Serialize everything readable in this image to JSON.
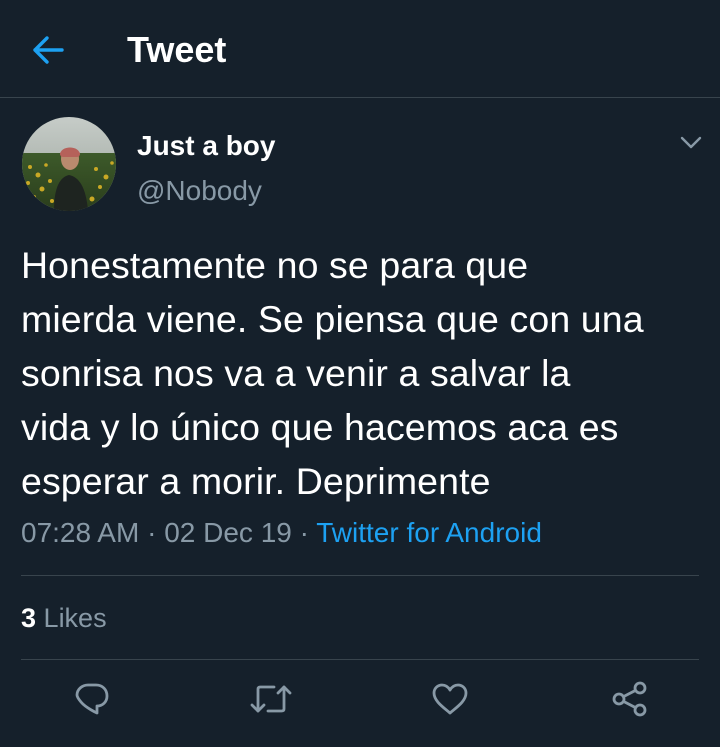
{
  "header": {
    "title": "Tweet",
    "back_icon": "arrow-left-icon"
  },
  "tweet": {
    "display_name": "Just a boy",
    "handle": "@Nobody",
    "text_lines": [
      "Honestamente no se para que",
      "mierda viene. Se piensa que con una",
      "sonrisa nos va a venir a salvar la",
      "vida y lo único que hacemos aca es",
      "esperar a morir. Deprimente"
    ],
    "time": "07:28 AM",
    "date": "02 Dec 19",
    "separator": "·",
    "source": "Twitter for Android"
  },
  "stats": {
    "likes_count": "3",
    "likes_label": "Likes"
  },
  "actions": {
    "reply_icon": "reply-icon",
    "retweet_icon": "retweet-icon",
    "like_icon": "heart-icon",
    "share_icon": "share-icon"
  },
  "colors": {
    "background": "#15202b",
    "accent": "#1da1f2",
    "secondary_text": "#8899a6",
    "divider": "#38444d"
  }
}
